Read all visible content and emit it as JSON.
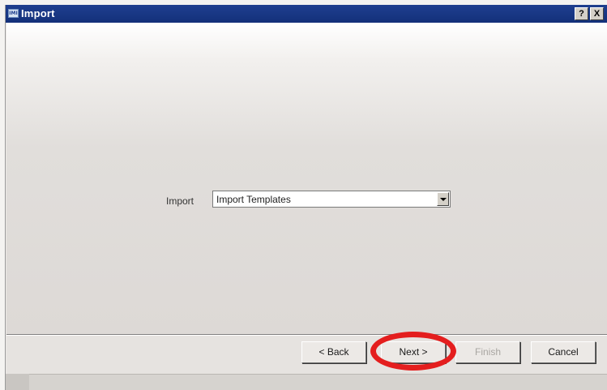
{
  "window": {
    "title": "Import",
    "icon_text": "IMI",
    "help_label": "?",
    "close_label": "X"
  },
  "form": {
    "import_label": "Import",
    "import_value": "Import Templates"
  },
  "buttons": {
    "back": "< Back",
    "next": "Next >",
    "finish": "Finish",
    "cancel": "Cancel"
  },
  "annotation": {
    "ring_color": "#e41e1e",
    "highlights": "next-button"
  },
  "colors": {
    "titlebar": "#1f3f8f",
    "window_bg": "#ece9e6"
  }
}
